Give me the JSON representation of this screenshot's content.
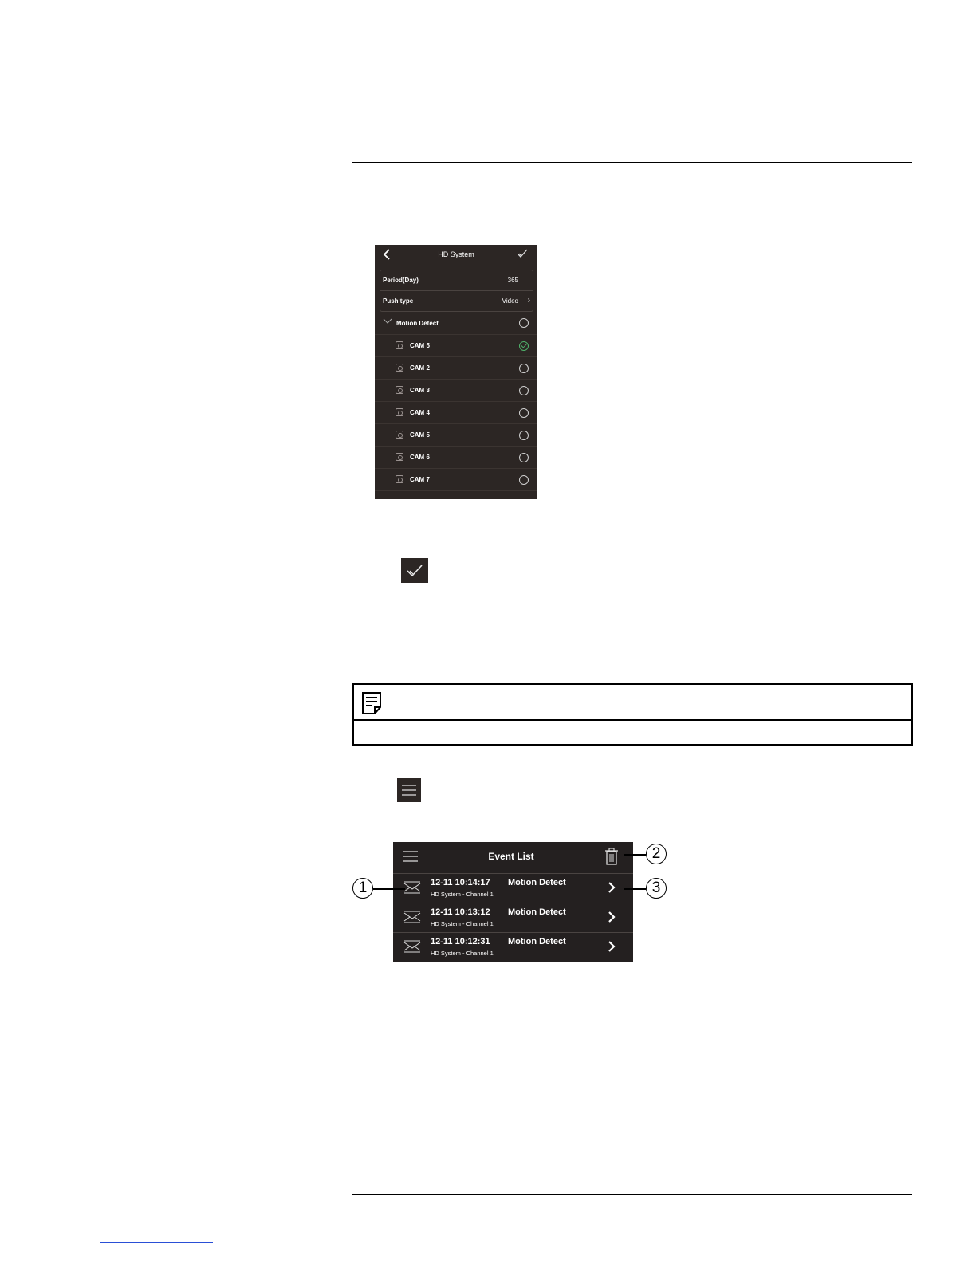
{
  "screen1": {
    "title": "HD System",
    "period_label": "Period(Day)",
    "period_value": "365",
    "push_type_label": "Push type",
    "push_type_value": "Video",
    "motion_detect_label": "Motion Detect",
    "cameras": [
      {
        "label": "CAM 5",
        "selected": true
      },
      {
        "label": "CAM 2",
        "selected": false
      },
      {
        "label": "CAM 3",
        "selected": false
      },
      {
        "label": "CAM 4",
        "selected": false
      },
      {
        "label": "CAM 5",
        "selected": false
      },
      {
        "label": "CAM 6",
        "selected": false
      },
      {
        "label": "CAM 7",
        "selected": false
      }
    ]
  },
  "screen2": {
    "title": "Event List",
    "events": [
      {
        "time": "12-11 10:14:17",
        "type": "Motion Detect",
        "source": "HD System - Channel 1"
      },
      {
        "time": "12-11 10:13:12",
        "type": "Motion Detect",
        "source": "HD System - Channel 1"
      },
      {
        "time": "12-11 10:12:31",
        "type": "Motion Detect",
        "source": "HD System - Channel 1"
      }
    ]
  },
  "callouts": {
    "one": "1",
    "two": "2",
    "three": "3"
  },
  "colors": {
    "app_background": "#2c2624",
    "selected_check": "#4fb06a"
  }
}
